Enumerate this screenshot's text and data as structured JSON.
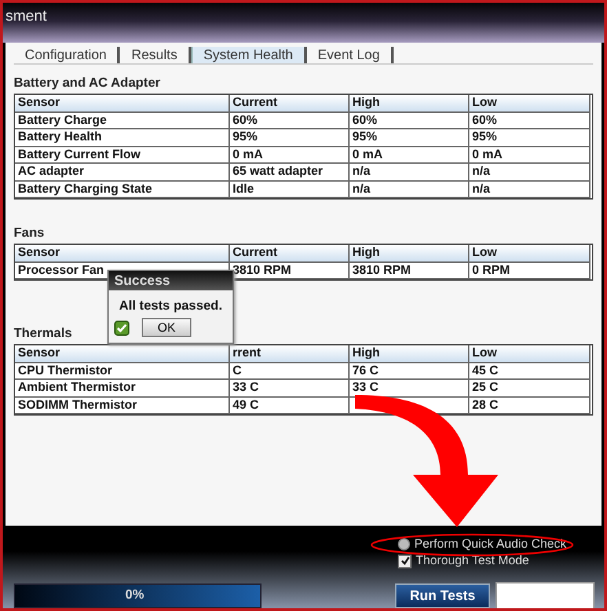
{
  "window": {
    "title": "sment"
  },
  "tabs": [
    {
      "label": "Configuration",
      "selected": false
    },
    {
      "label": "Results",
      "selected": false
    },
    {
      "label": "System Health",
      "selected": true
    },
    {
      "label": "Event Log",
      "selected": false
    }
  ],
  "sections": [
    {
      "title": "Battery and AC Adapter",
      "columns": [
        "Sensor",
        "Current",
        "High",
        "Low"
      ],
      "rows": [
        [
          "Battery Charge",
          "60%",
          "60%",
          "60%"
        ],
        [
          "Battery Health",
          "95%",
          "95%",
          "95%"
        ],
        [
          "Battery Current Flow",
          "0 mA",
          "0 mA",
          "0 mA"
        ],
        [
          "AC adapter",
          "65 watt adapter",
          "n/a",
          "n/a"
        ],
        [
          "Battery Charging State",
          "Idle",
          "n/a",
          "n/a"
        ]
      ]
    },
    {
      "title": "Fans",
      "columns": [
        "Sensor",
        "Current",
        "High",
        "Low"
      ],
      "rows": [
        [
          "Processor Fan",
          "3810 RPM",
          "3810 RPM",
          "0 RPM"
        ]
      ]
    },
    {
      "title": "Thermals",
      "columns": [
        "Sensor",
        "rrent",
        "High",
        "Low"
      ],
      "rows": [
        [
          "CPU Thermistor",
          "C",
          "76 C",
          "45 C"
        ],
        [
          "Ambient Thermistor",
          "33 C",
          "33 C",
          "25 C"
        ],
        [
          "SODIMM Thermistor",
          "49 C",
          "",
          "28 C"
        ]
      ]
    }
  ],
  "dialog": {
    "title": "Success",
    "message": "All tests passed.",
    "button": "OK"
  },
  "options": [
    {
      "kind": "radio",
      "label": "Perform Quick Audio Check",
      "selected": false
    },
    {
      "kind": "checkbox",
      "label": "Thorough Test Mode",
      "checked": true
    }
  ],
  "progress": {
    "label": "0%",
    "level": 0
  },
  "run_button": "Run Tests"
}
